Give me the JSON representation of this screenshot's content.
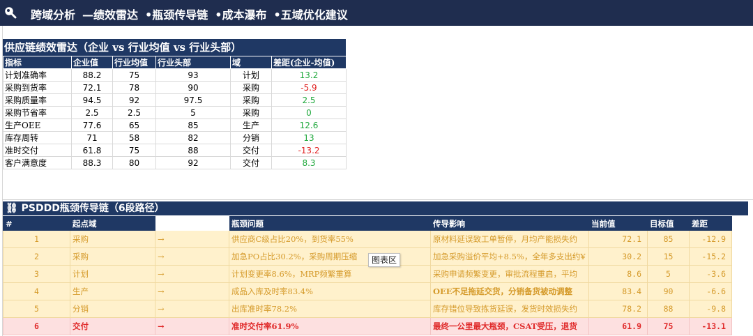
{
  "header": {
    "items": [
      "跨域分析",
      "绩效雷达",
      "瓶颈传导链",
      "成本瀑布",
      "五域优化建议"
    ],
    "first_sep": "—",
    "sep": "•"
  },
  "radar": {
    "title": "供应链绩效雷达（企业 vs 行业均值 vs 行业头部）",
    "columns": [
      "指标",
      "企业值",
      "行业均值",
      "行业头部",
      "域",
      "差距(企业-均值)"
    ],
    "rows": [
      {
        "metric": "计划准确率",
        "company": "88.2",
        "avg": "75",
        "top": "93",
        "domain": "计划",
        "gap": "13.2",
        "sign": "pos"
      },
      {
        "metric": "采购到货率",
        "company": "72.1",
        "avg": "78",
        "top": "90",
        "domain": "采购",
        "gap": "-5.9",
        "sign": "neg"
      },
      {
        "metric": "采购质量率",
        "company": "94.5",
        "avg": "92",
        "top": "97.5",
        "domain": "采购",
        "gap": "2.5",
        "sign": "pos"
      },
      {
        "metric": "采购节省率",
        "company": "2.5",
        "avg": "2.5",
        "top": "5",
        "domain": "采购",
        "gap": "0",
        "sign": "pos"
      },
      {
        "metric": "生产OEE",
        "company": "77.6",
        "avg": "65",
        "top": "85",
        "domain": "生产",
        "gap": "12.6",
        "sign": "pos"
      },
      {
        "metric": "库存周转",
        "company": "71",
        "avg": "58",
        "top": "82",
        "domain": "分销",
        "gap": "13",
        "sign": "pos"
      },
      {
        "metric": "准时交付",
        "company": "61.8",
        "avg": "75",
        "top": "88",
        "domain": "交付",
        "gap": "-13.2",
        "sign": "neg"
      },
      {
        "metric": "客户满意度",
        "company": "88.3",
        "avg": "80",
        "top": "92",
        "domain": "交付",
        "gap": "8.3",
        "sign": "pos"
      }
    ]
  },
  "chain": {
    "title": "⛓ PSDDD瓶颈传导链（6段路径）",
    "columns": [
      "#",
      "起点域",
      "",
      "瓶颈问题",
      "传导影响",
      "当前值",
      "目标值",
      "差距"
    ],
    "arrow": "→",
    "rows": [
      {
        "n": "1",
        "domain": "采购",
        "issue": "供应商C级占比20%，到货率55%",
        "impact": "原材料延误致工单暂停，月均产能损失约",
        "cur": "72.1",
        "target": "85",
        "gap": "-12.9"
      },
      {
        "n": "2",
        "domain": "采购",
        "issue": "加急PO占比30.2%，采购周期压缩",
        "impact": "加急采购溢价平均+8.5%，全年多支出约¥",
        "cur": "30.2",
        "target": "15",
        "gap": "-15.2"
      },
      {
        "n": "3",
        "domain": "计划",
        "issue": "计划变更率8.6%，MRP频繁重算",
        "impact": "采购申请频繁变更，审批流程重启，平均",
        "cur": "8.6",
        "target": "5",
        "gap": "-3.6"
      },
      {
        "n": "4",
        "domain": "生产",
        "issue": "成品入库及时率83.4%",
        "impact": "OEE不足拖延交货，分销备货被动调整",
        "cur": "83.4",
        "target": "90",
        "gap": "-6.6"
      },
      {
        "n": "5",
        "domain": "分销",
        "issue": "出库准时率78.2%",
        "impact": "库存错位导致拣货延误，发货时效损失约",
        "cur": "78.2",
        "target": "88",
        "gap": "-9.8"
      },
      {
        "n": "6",
        "domain": "交付",
        "issue": "准时交付率61.9%",
        "impact": "最终一公里最大瓶颈，CSAT受压，退货",
        "cur": "61.9",
        "target": "75",
        "gap": "-13.1"
      }
    ]
  },
  "tooltip": "图表区"
}
